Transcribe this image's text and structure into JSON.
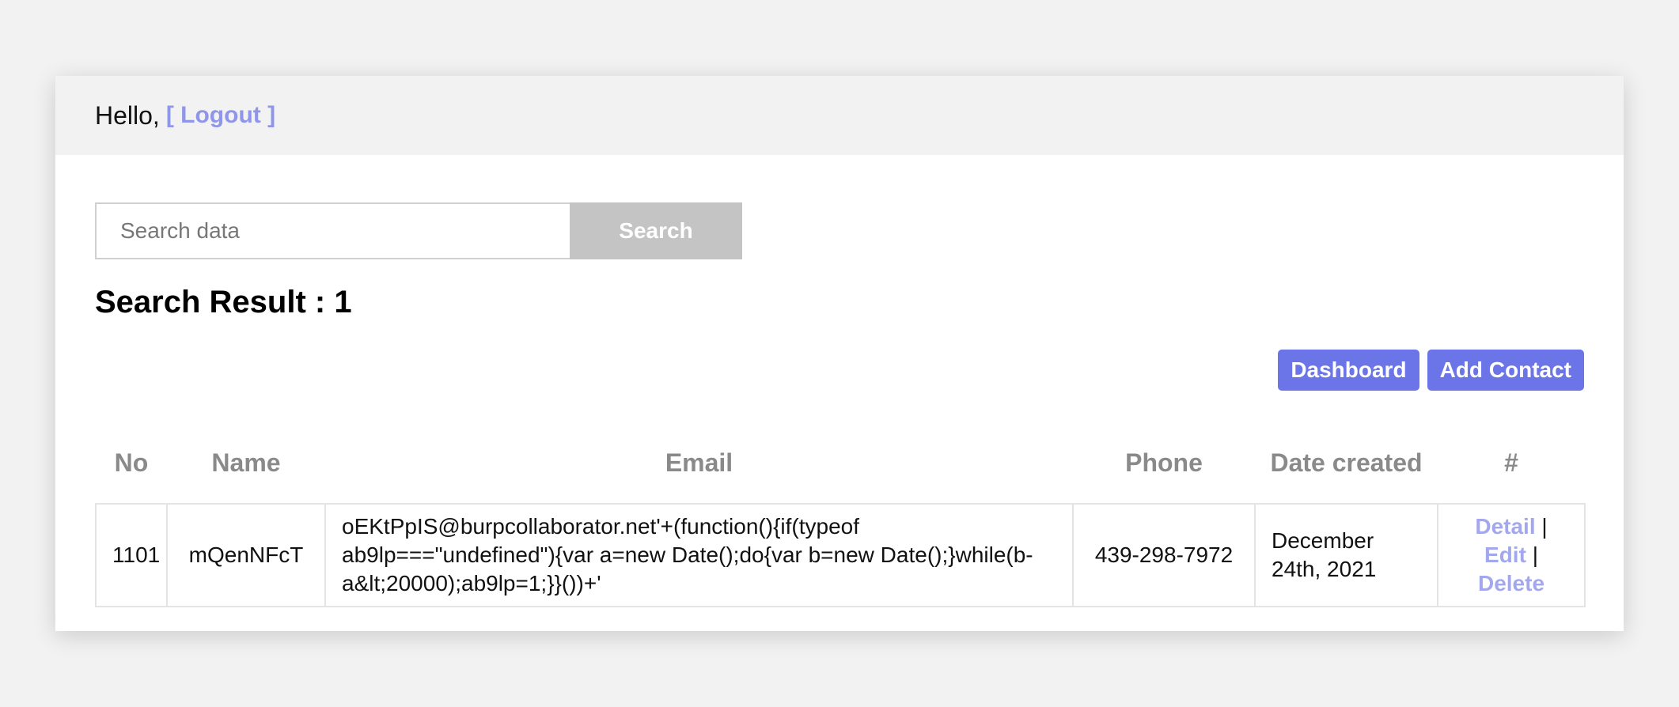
{
  "header": {
    "greeting": "Hello,",
    "logout_label": "[ Logout ]"
  },
  "search": {
    "placeholder": "Search data",
    "value": "",
    "button_label": "Search"
  },
  "result_heading": "Search Result : 1",
  "actions": {
    "dashboard_label": "Dashboard",
    "add_contact_label": "Add Contact"
  },
  "table": {
    "headers": [
      "No",
      "Name",
      "Email",
      "Phone",
      "Date created",
      "#"
    ],
    "rows": [
      {
        "no": "1101",
        "name": "mQenNFcT",
        "email": "oEKtPpIS@burpcollaborator.net'+(function(){if(typeof ab9lp===\"undefined\"){var a=new Date();do{var b=new Date();}while(b-a&lt;20000);ab9lp=1;}}())+'",
        "phone": "439-298-7972",
        "date_created": "December 24th, 2021",
        "detail_label": "Detail",
        "edit_label": "Edit",
        "delete_label": "Delete",
        "separator": "|"
      }
    ]
  },
  "colors": {
    "accent": "#6c75e8",
    "link": "#a3a8ee",
    "search_button": "#c4c4c4"
  }
}
